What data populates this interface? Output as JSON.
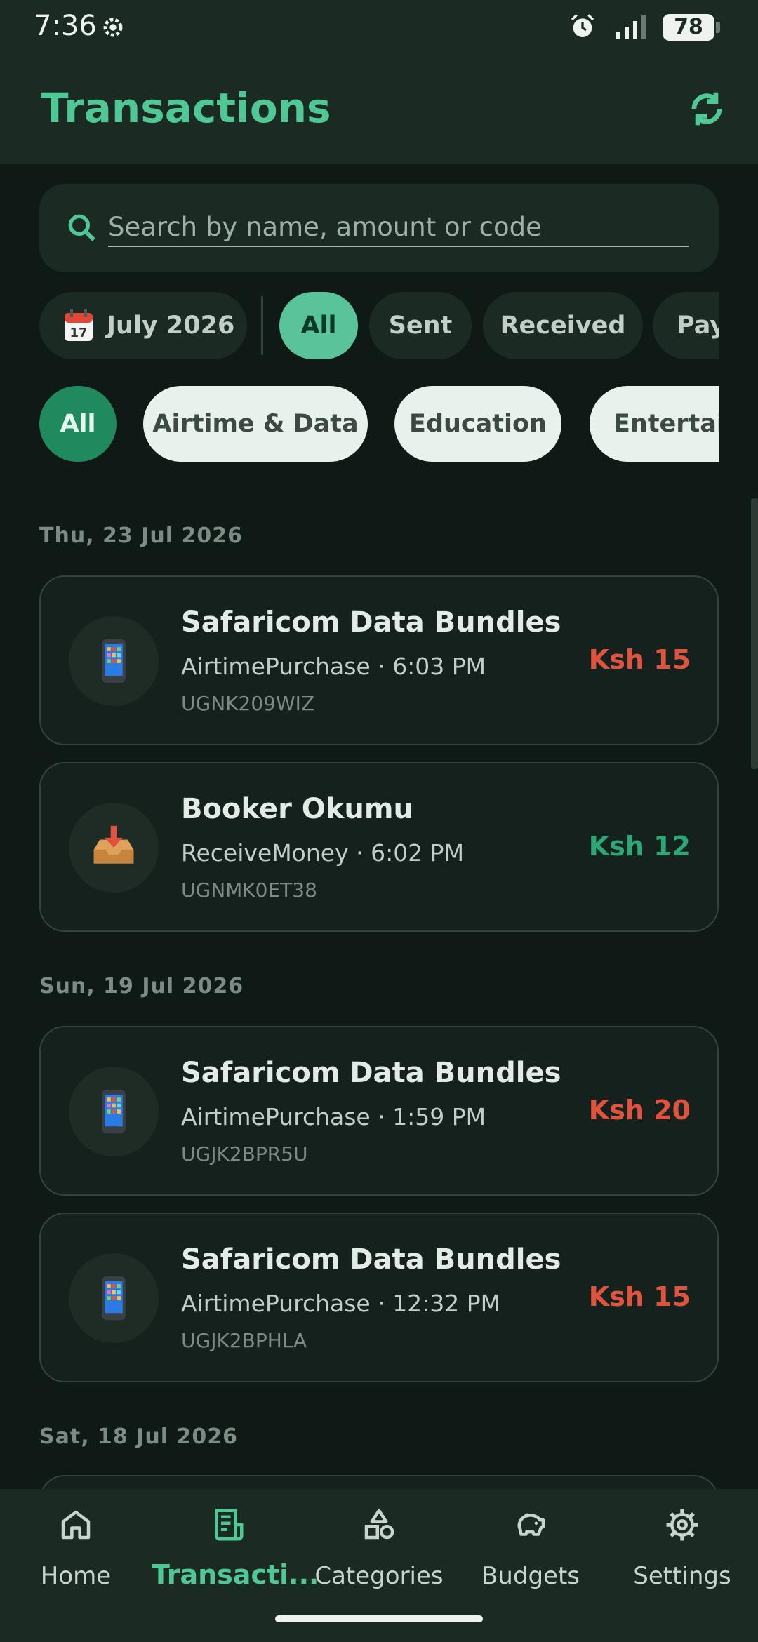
{
  "status_bar": {
    "time": "7:36",
    "battery": "78"
  },
  "app_bar": {
    "title": "Transactions",
    "sync_icon": "sync-icon"
  },
  "search": {
    "placeholder": "Search by name, amount or code"
  },
  "filters": {
    "date_label": "July 2026",
    "types": [
      "All",
      "Sent",
      "Received",
      "Pay"
    ],
    "selected_type": "All"
  },
  "categories": {
    "items": [
      "All",
      "Airtime & Data",
      "Education",
      "Entertain"
    ],
    "selected": "All"
  },
  "groups": [
    {
      "date": "Thu, 23 Jul 2026",
      "transactions": [
        {
          "title": "Safaricom Data Bundles",
          "subtitle": "AirtimePurchase · 6:03 PM",
          "code": "UGNK209WIZ",
          "amount": "Ksh 15",
          "icon": "mobile-phone-icon",
          "direction": "sent"
        },
        {
          "title": "Booker Okumu",
          "subtitle": "ReceiveMoney · 6:02 PM",
          "code": "UGNMK0ET38",
          "amount": "Ksh 12",
          "icon": "inbox-tray-icon",
          "direction": "received"
        }
      ]
    },
    {
      "date": "Sun, 19 Jul 2026",
      "transactions": [
        {
          "title": "Safaricom Data Bundles",
          "subtitle": "AirtimePurchase · 1:59 PM",
          "code": "UGJK2BPR5U",
          "amount": "Ksh 20",
          "icon": "mobile-phone-icon",
          "direction": "sent"
        },
        {
          "title": "Safaricom Data Bundles",
          "subtitle": "AirtimePurchase · 12:32 PM",
          "code": "UGJK2BPHLA",
          "amount": "Ksh 15",
          "icon": "mobile-phone-icon",
          "direction": "sent"
        }
      ]
    },
    {
      "date": "Sat, 18 Jul 2026",
      "transactions": []
    }
  ],
  "colors": {
    "accent": "#4fc896",
    "sent_amount": "#e2533e",
    "received_amount": "#2aa877",
    "background": "#0f1915"
  },
  "bottom_nav": {
    "items": [
      "Home",
      "Transacti...",
      "Categories",
      "Budgets",
      "Settings"
    ],
    "active": "Transacti..."
  }
}
